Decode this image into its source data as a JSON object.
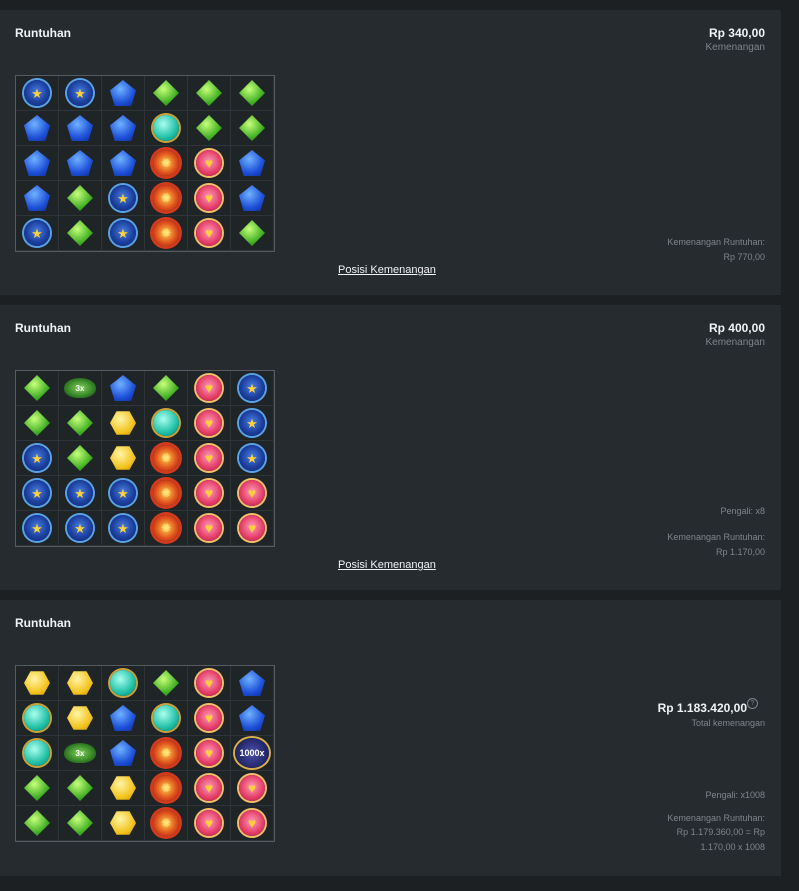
{
  "panels": [
    {
      "title": "Runtuhan",
      "win_amount": "Rp 340,00",
      "win_label": "Kemenangan",
      "cascade_label": "Kemenangan Runtuhan:",
      "cascade_value": "Rp 770,00",
      "link": "Posisi Kemenangan",
      "grid": [
        [
          "star",
          "star",
          "blue",
          "green",
          "green",
          "green"
        ],
        [
          "blue",
          "blue",
          "blue",
          "teal",
          "green",
          "green"
        ],
        [
          "blue",
          "blue",
          "blue",
          "sun",
          "heart",
          "blue"
        ],
        [
          "blue",
          "green",
          "star",
          "sun",
          "heart",
          "blue"
        ],
        [
          "star",
          "green",
          "star",
          "sun",
          "heart",
          "green"
        ]
      ]
    },
    {
      "title": "Runtuhan",
      "win_amount": "Rp 400,00",
      "win_label": "Kemenangan",
      "multiplier": "Pengali: x8",
      "cascade_label": "Kemenangan Runtuhan:",
      "cascade_value": "Rp 1.170,00",
      "link": "Posisi Kemenangan",
      "grid": [
        [
          "green",
          "mult:3x",
          "blue",
          "green",
          "heart",
          "star"
        ],
        [
          "green",
          "green",
          "yellow",
          "teal",
          "heart",
          "star"
        ],
        [
          "star",
          "green",
          "yellow",
          "sun",
          "heart",
          "star"
        ],
        [
          "star",
          "star",
          "star",
          "sun",
          "heart",
          "heart"
        ],
        [
          "star",
          "star",
          "star",
          "sun",
          "heart",
          "heart"
        ]
      ]
    },
    {
      "title": "Runtuhan",
      "total_amount": "Rp 1.183.420,00",
      "total_label": "Total kemenangan",
      "help_glyph": "?",
      "multiplier": "Pengali: x1008",
      "cascade_label": "Kemenangan Runtuhan:",
      "cascade_value_line1": "Rp 1.179.360,00 = Rp",
      "cascade_value_line2": "1.170,00 x 1008",
      "grid": [
        [
          "yellow",
          "yellow",
          "teal",
          "green",
          "heart",
          "blue"
        ],
        [
          "teal",
          "yellow",
          "blue",
          "teal",
          "heart",
          "blue"
        ],
        [
          "teal",
          "mult:3x",
          "blue",
          "sun",
          "heart",
          "multbig:1000x"
        ],
        [
          "green",
          "green",
          "yellow",
          "sun",
          "heart",
          "heart"
        ],
        [
          "green",
          "green",
          "yellow",
          "sun",
          "heart",
          "heart"
        ]
      ]
    }
  ]
}
